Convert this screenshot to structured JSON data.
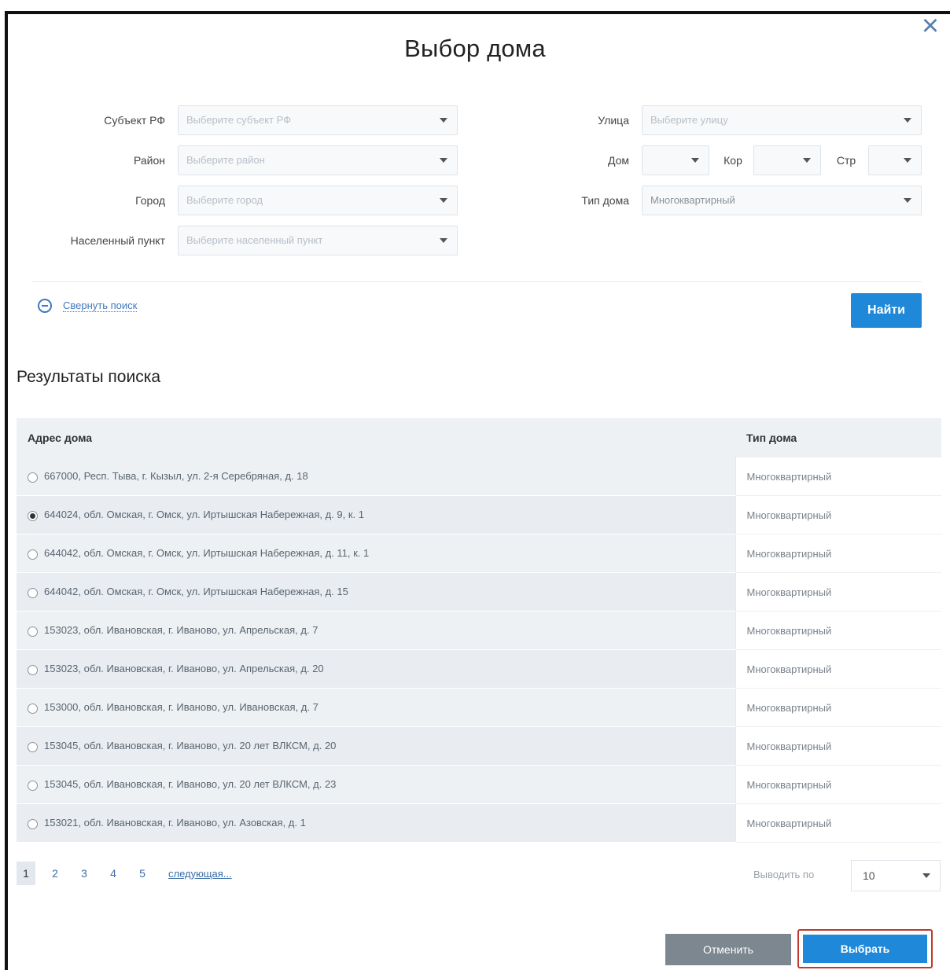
{
  "dialog": {
    "title": "Выбор дома",
    "close_icon": "close-icon"
  },
  "filters": {
    "subject_label": "Субъект РФ",
    "subject_placeholder": "Выберите субъект РФ",
    "district_label": "Район",
    "district_placeholder": "Выберите район",
    "city_label": "Город",
    "city_placeholder": "Выберите город",
    "settlement_label": "Населенный пункт",
    "settlement_placeholder": "Выберите населенный пункт",
    "street_label": "Улица",
    "street_placeholder": "Выберите улицу",
    "house_label": "Дом",
    "house_value": "",
    "korp_label": "Кор",
    "korp_value": "",
    "str_label": "Стр",
    "str_value": "",
    "house_type_label": "Тип дома",
    "house_type_value": "Многоквартирный"
  },
  "search": {
    "collapse_label": "Свернуть поиск",
    "find_button": "Найти"
  },
  "results": {
    "title": "Результаты поиска",
    "columns": [
      "Адрес дома",
      "Тип дома"
    ],
    "rows": [
      {
        "address": "667000, Респ. Тыва, г. Кызыл, ул. 2-я Серебряная, д. 18",
        "type": "Многоквартирный",
        "selected": false
      },
      {
        "address": "644024, обл. Омская, г. Омск, ул. Иртышская Набережная, д. 9, к. 1",
        "type": "Многоквартирный",
        "selected": true
      },
      {
        "address": "644042, обл. Омская, г. Омск, ул. Иртышская Набережная, д. 11, к. 1",
        "type": "Многоквартирный",
        "selected": false
      },
      {
        "address": "644042, обл. Омская, г. Омск, ул. Иртышская Набережная, д. 15",
        "type": "Многоквартирный",
        "selected": false
      },
      {
        "address": "153023, обл. Ивановская, г. Иваново, ул. Апрельская, д. 7",
        "type": "Многоквартирный",
        "selected": false
      },
      {
        "address": "153023, обл. Ивановская, г. Иваново, ул. Апрельская, д. 20",
        "type": "Многоквартирный",
        "selected": false
      },
      {
        "address": "153000, обл. Ивановская, г. Иваново, ул. Ивановская, д. 7",
        "type": "Многоквартирный",
        "selected": false
      },
      {
        "address": "153045, обл. Ивановская, г. Иваново, ул. 20 лет ВЛКСМ, д. 20",
        "type": "Многоквартирный",
        "selected": false
      },
      {
        "address": "153045, обл. Ивановская, г. Иваново, ул. 20 лет ВЛКСМ, д. 23",
        "type": "Многоквартирный",
        "selected": false
      },
      {
        "address": "153021, обл. Ивановская, г. Иваново, ул. Азовская, д. 1",
        "type": "Многоквартирный",
        "selected": false
      }
    ]
  },
  "pagination": {
    "pages": [
      "1",
      "2",
      "3",
      "4",
      "5"
    ],
    "current_page": "1",
    "next_label": "следующая...",
    "per_page_label": "Выводить по",
    "per_page_value": "10"
  },
  "actions": {
    "cancel": "Отменить",
    "select": "Выбрать"
  }
}
